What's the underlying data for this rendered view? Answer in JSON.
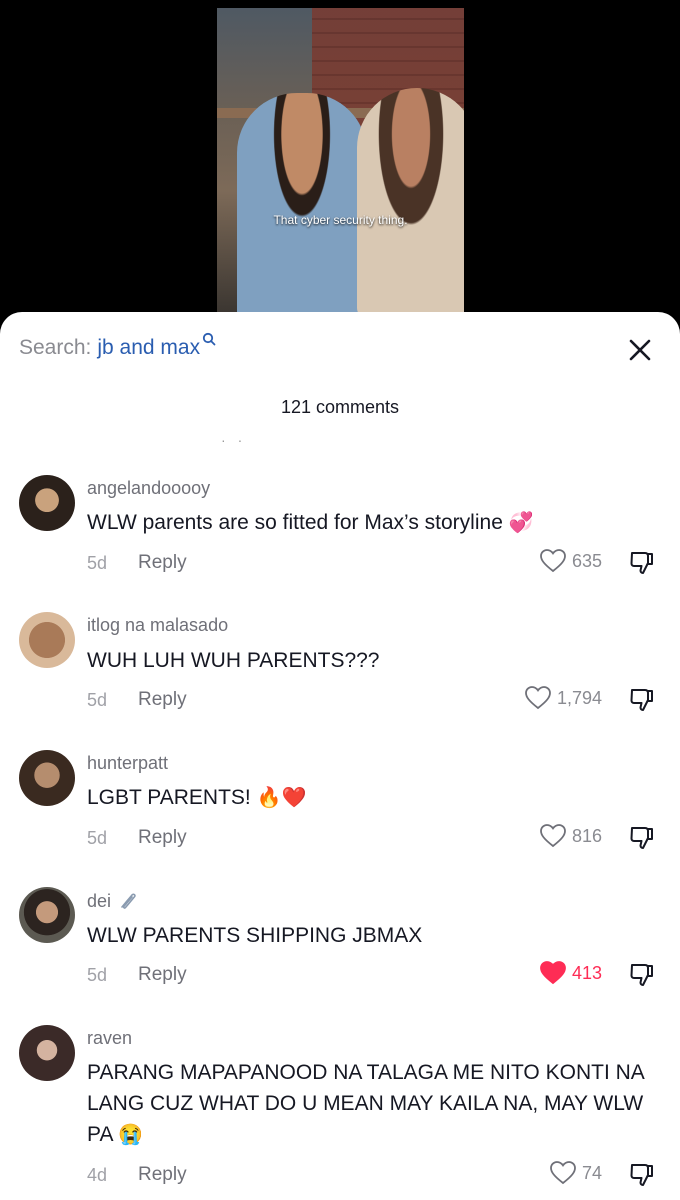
{
  "video": {
    "subtitle": "That cyber security thing."
  },
  "search": {
    "prefix": "Search:",
    "query": "jb and max"
  },
  "comments_header": {
    "count_label": "121 comments"
  },
  "reply_label": "Reply",
  "colors": {
    "accent_link": "#2a5db0",
    "liked": "#fe2c55"
  },
  "comments": [
    {
      "username": "angelandooooy",
      "text": "WLW parents are so fitted for Max’s storyline",
      "emoji": "💞",
      "time": "5d",
      "likes": "635",
      "liked": false
    },
    {
      "username": "itlog na malasado",
      "text": "WUH LUH WUH PARENTS???",
      "emoji": "",
      "time": "5d",
      "likes": "1,794",
      "liked": false
    },
    {
      "username": "hunterpatt",
      "text": "LGBT PARENTS!",
      "emoji": "🔥❤️",
      "time": "5d",
      "likes": "816",
      "liked": false
    },
    {
      "username": "dei",
      "username_icon": "paperclip-icon",
      "text": "WLW PARENTS SHIPPING JBMAX",
      "emoji": "",
      "time": "5d",
      "likes": "413",
      "liked": true
    },
    {
      "username": "raven",
      "text": "PARANG MAPAPANOOD NA TALAGA ME NITO KONTI NA LANG CUZ WHAT DO U MEAN MAY KAILA NA, MAY WLW PA",
      "emoji": "😭",
      "time": "4d",
      "likes": "74",
      "liked": false
    }
  ]
}
